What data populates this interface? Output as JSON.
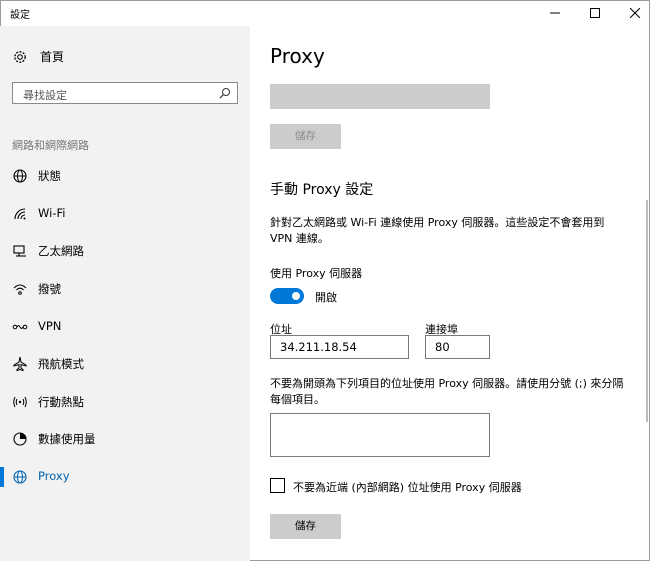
{
  "window": {
    "title": "設定"
  },
  "sidebar": {
    "home_label": "首頁",
    "search_placeholder": "尋找設定",
    "section_label": "網路和網際網路",
    "items": [
      {
        "label": "狀態",
        "icon": "status-globe-icon"
      },
      {
        "label": "Wi-Fi",
        "icon": "wifi-icon"
      },
      {
        "label": "乙太網路",
        "icon": "ethernet-icon"
      },
      {
        "label": "撥號",
        "icon": "dialup-icon"
      },
      {
        "label": "VPN",
        "icon": "vpn-icon"
      },
      {
        "label": "飛航模式",
        "icon": "airplane-icon"
      },
      {
        "label": "行動熱點",
        "icon": "hotspot-icon"
      },
      {
        "label": "數據使用量",
        "icon": "data-usage-icon"
      },
      {
        "label": "Proxy",
        "icon": "globe-icon",
        "active": true
      }
    ]
  },
  "main": {
    "title": "Proxy",
    "save_top_label": "儲存",
    "manual_section_title": "手動 Proxy 設定",
    "description": "針對乙太網路或 Wi-Fi 連線使用 Proxy 伺服器。這些設定不會套用到 VPN 連線。",
    "use_proxy_label": "使用 Proxy 伺服器",
    "toggle_state": "開啟",
    "address_label": "位址",
    "address_value": "34.211.18.54",
    "port_label": "連接埠",
    "port_value": "80",
    "exclude_description": "不要為開頭為下列項目的位址使用 Proxy 伺服器。請使用分號 (;) 來分隔每個項目。",
    "exclude_value": "",
    "local_checkbox_label": "不要為近端 (內部網路) 位址使用 Proxy 伺服器",
    "local_checkbox_checked": false,
    "save_bottom_label": "儲存"
  },
  "colors": {
    "accent": "#0078d7",
    "sidebar_bg": "#f2f2f2",
    "button_bg": "#cccccc"
  }
}
